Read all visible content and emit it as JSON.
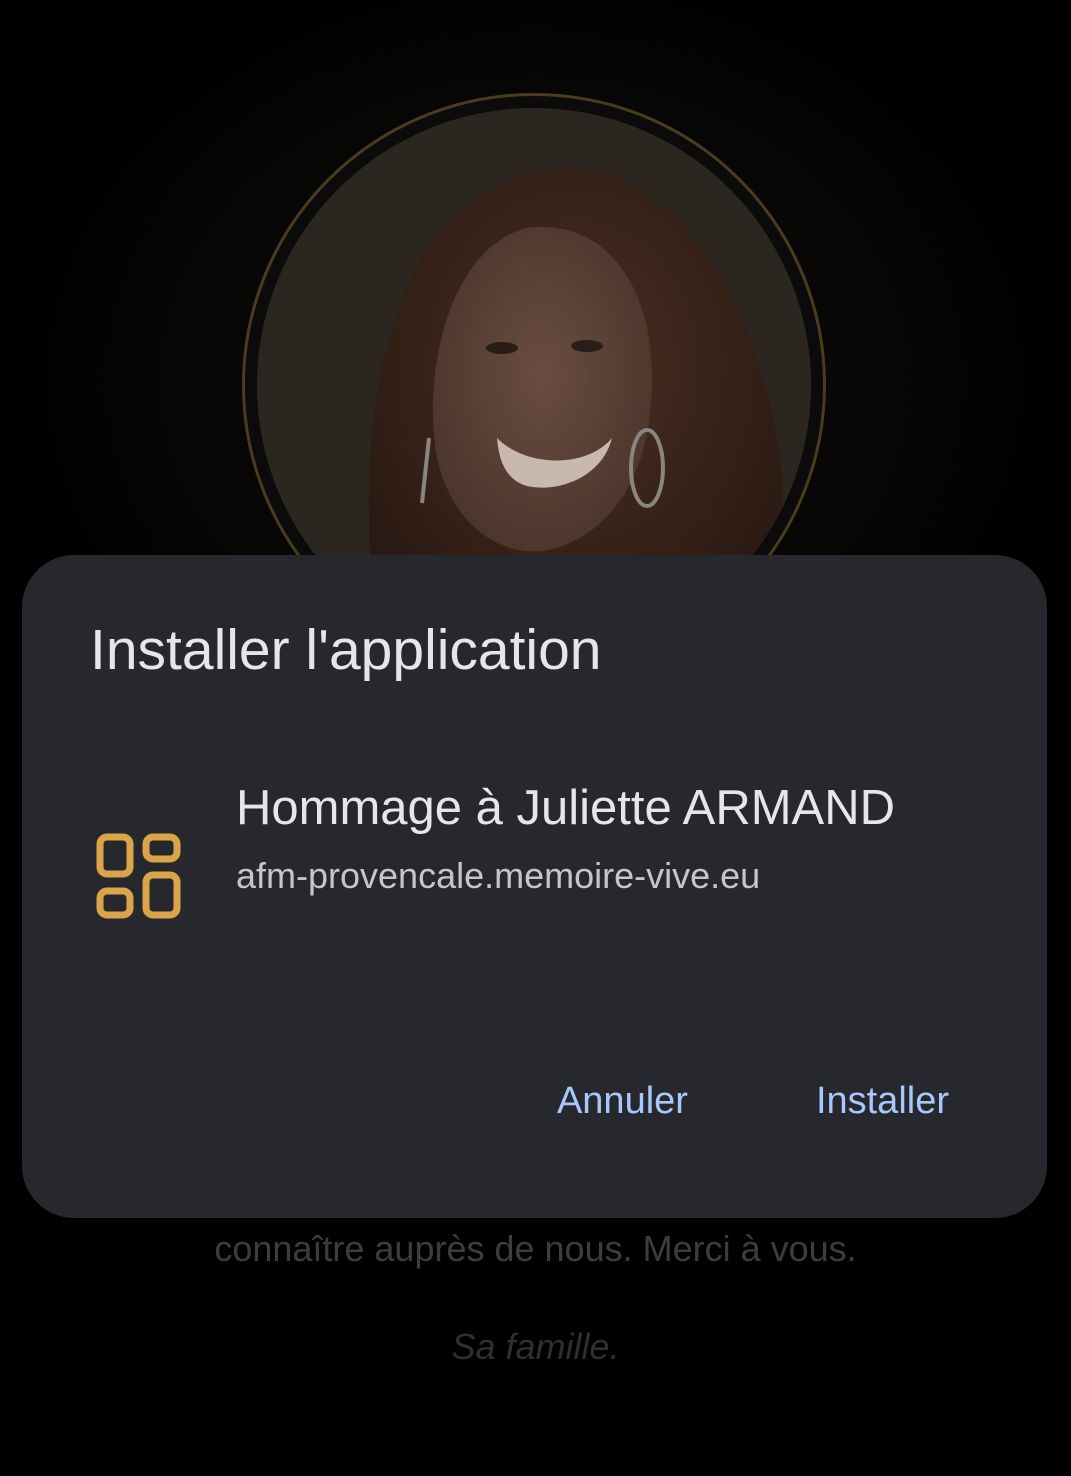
{
  "background": {
    "message_line": "connaître auprès de nous. Merci à vous.",
    "signature": "Sa famille."
  },
  "dialog": {
    "title": "Installer l'application",
    "app_icon": "apps-grid-icon",
    "app_name": "Hommage à Juliette ARMAND",
    "app_url": "afm-provencale.memoire-vive.eu",
    "cancel_label": "Annuler",
    "install_label": "Installer"
  },
  "colors": {
    "dialog_bg": "#27282d",
    "button_text": "#a8c7fa",
    "icon_accent": "#d9a548",
    "ring_gold": "#4a3c1c"
  }
}
